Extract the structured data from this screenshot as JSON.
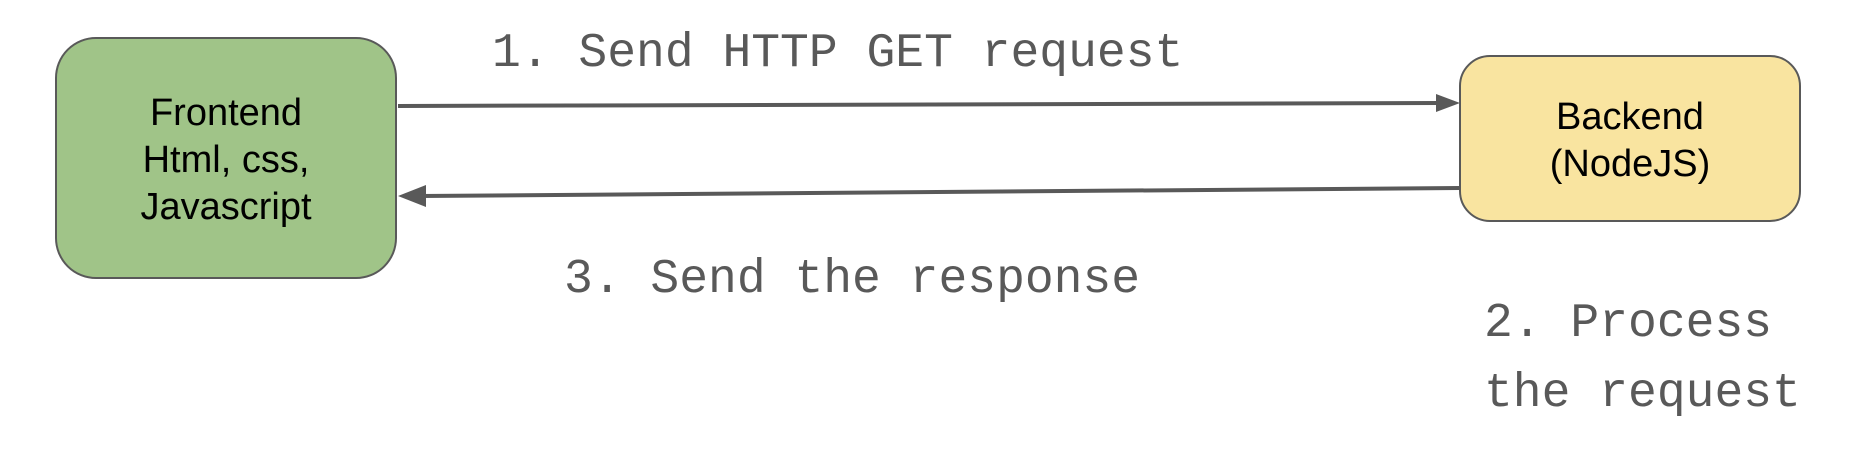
{
  "nodes": {
    "frontend": {
      "lines": [
        "Frontend",
        "Html, css,",
        "Javascript"
      ],
      "fill": "#a0c488",
      "stroke": "#595959"
    },
    "backend": {
      "lines": [
        "Backend",
        "(NodeJS)"
      ],
      "fill": "#f9e4a0",
      "stroke": "#595959"
    }
  },
  "edges": {
    "request": {
      "label": "1. Send HTTP GET request",
      "from": "frontend",
      "to": "backend"
    },
    "response": {
      "label": "3. Send the response",
      "from": "backend",
      "to": "frontend"
    }
  },
  "process_note": {
    "lines": [
      "2. Process",
      "the request"
    ]
  },
  "colors": {
    "arrow": "#595959",
    "label": "#595959",
    "text": "#000000"
  }
}
